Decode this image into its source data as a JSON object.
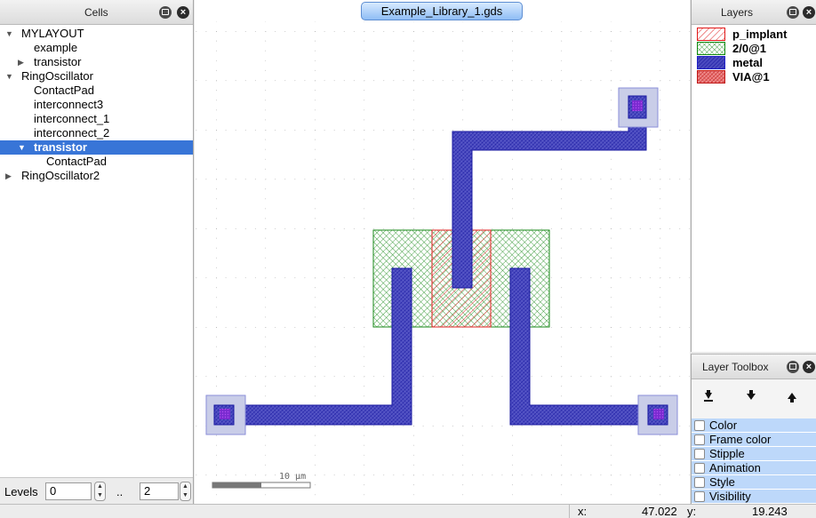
{
  "cells_panel": {
    "title": "Cells",
    "tree": [
      {
        "label": "MYLAYOUT",
        "depth": 0,
        "arrow": "▼",
        "selected": false
      },
      {
        "label": "example",
        "depth": 1,
        "arrow": "",
        "selected": false
      },
      {
        "label": "transistor",
        "depth": 1,
        "arrow": "▶",
        "selected": false
      },
      {
        "label": "RingOscillator",
        "depth": 0,
        "arrow": "▼",
        "selected": false
      },
      {
        "label": "ContactPad",
        "depth": 1,
        "arrow": "",
        "selected": false
      },
      {
        "label": "interconnect3",
        "depth": 1,
        "arrow": "",
        "selected": false
      },
      {
        "label": "interconnect_1",
        "depth": 1,
        "arrow": "",
        "selected": false
      },
      {
        "label": "interconnect_2",
        "depth": 1,
        "arrow": "",
        "selected": false
      },
      {
        "label": "transistor",
        "depth": 1,
        "arrow": "▼",
        "selected": true
      },
      {
        "label": "ContactPad",
        "depth": 2,
        "arrow": "",
        "selected": false
      },
      {
        "label": "RingOscillator2",
        "depth": 0,
        "arrow": "▶",
        "selected": false
      }
    ],
    "levels_label": "Levels",
    "level_from": "0",
    "level_sep": "..",
    "level_to": "2"
  },
  "canvas": {
    "tab_title": "Example_Library_1.gds",
    "scale_label": "10 µm"
  },
  "layers_panel": {
    "title": "Layers",
    "layers": [
      {
        "name": "p_implant",
        "color": "#e01818",
        "pattern": "diag"
      },
      {
        "name": "2/0@1",
        "color": "#108a10",
        "pattern": "cross"
      },
      {
        "name": "metal",
        "color": "#2020c8",
        "pattern": "dense"
      },
      {
        "name": "VIA@1",
        "color": "#c01818",
        "pattern": "denseRed"
      }
    ]
  },
  "toolbox": {
    "title": "Layer Toolbox",
    "items": [
      "Color",
      "Frame color",
      "Stipple",
      "Animation",
      "Style",
      "Visibility"
    ]
  },
  "status": {
    "x_label": "x:",
    "x_value": "47.022",
    "y_label": "y:",
    "y_value": "19.243"
  }
}
